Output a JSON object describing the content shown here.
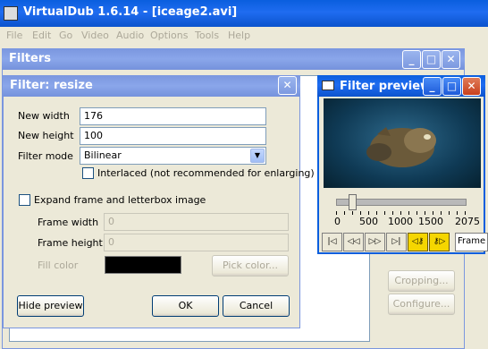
{
  "app": {
    "title": "VirtualDub 1.6.14 - [iceage2.avi]"
  },
  "menu": [
    "File",
    "Edit",
    "Go",
    "Video",
    "Audio",
    "Options",
    "Tools",
    "Help"
  ],
  "filters_window": {
    "title": "Filters",
    "buttons": {
      "cropping": "Cropping...",
      "configure": "Configure..."
    }
  },
  "resize_dialog": {
    "title": "Filter: resize",
    "new_width_label": "New width",
    "new_width_value": "176",
    "new_height_label": "New height",
    "new_height_value": "100",
    "filter_mode_label": "Filter mode",
    "filter_mode_value": "Bilinear",
    "interlaced_label": "Interlaced (not recommended for enlarging)",
    "expand_label": "Expand frame and letterbox image",
    "frame_width_label": "Frame width",
    "frame_width_value": "0",
    "frame_height_label": "Frame height",
    "frame_height_value": "0",
    "fill_color_label": "Fill color",
    "fill_color": "#000000",
    "pick_color_label": "Pick color...",
    "hide_preview_label": "Hide preview",
    "ok_label": "OK",
    "cancel_label": "Cancel"
  },
  "preview_window": {
    "title": "Filter preview",
    "ticks": [
      "0",
      "500",
      "1000",
      "1500",
      "2075"
    ],
    "slider_position": 0.125,
    "frame_label": "Frame"
  },
  "colors": {
    "titlebar_active": "#0a5ede",
    "titlebar_inactive": "#7a96df",
    "dialog_bg": "#ece9d8"
  }
}
